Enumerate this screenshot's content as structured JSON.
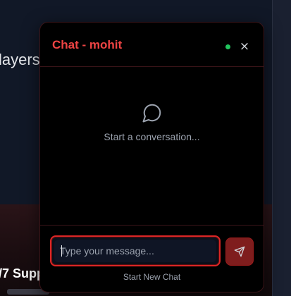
{
  "background": {
    "players_text": "layers",
    "support_text": "/7 Supp"
  },
  "chat": {
    "title": "Chat - mohit",
    "status": "online",
    "close_label": "×",
    "empty_state_text": "Start a conversation...",
    "input": {
      "value": "",
      "placeholder": "Type your message..."
    },
    "new_chat_label": "Start New Chat"
  },
  "colors": {
    "accent": "#ef4444",
    "status_online": "#22c55e",
    "send_button": "#7f1d1d"
  },
  "icons": {
    "empty_state": "message-circle-icon",
    "send": "send-icon",
    "close": "close-icon"
  }
}
